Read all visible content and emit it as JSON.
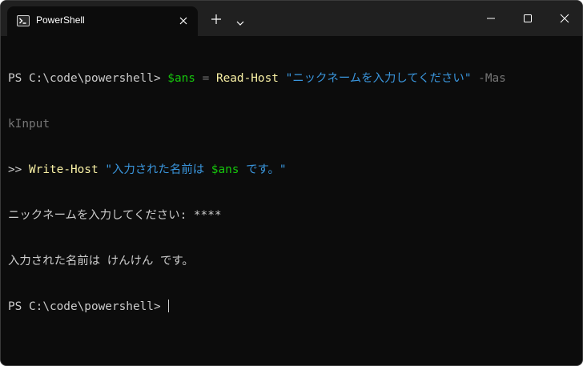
{
  "tab": {
    "title": "PowerShell",
    "icon": "powershell-icon"
  },
  "titlebar": {
    "new_tab_icon": "plus-icon",
    "dropdown_icon": "chevron-down-icon",
    "minimize_icon": "minimize-icon",
    "maximize_icon": "maximize-icon",
    "close_icon": "close-icon"
  },
  "colors": {
    "background": "#0c0c0c",
    "titlebar": "#202020",
    "text": "#cccccc",
    "variable": "#16c60c",
    "command": "#f9f1a5",
    "string": "#3a96dd",
    "parameter": "#767676"
  },
  "terminal": {
    "line1": {
      "prompt": "PS C:\\code\\powershell> ",
      "var": "$ans",
      "op": " = ",
      "cmd": "Read-Host",
      "space": " ",
      "str": "\"ニックネームを入力してください\"",
      "space2": " ",
      "param_part1": "-Mas"
    },
    "line2": {
      "param_part2": "kInput"
    },
    "line3": {
      "prompt": ">> ",
      "cmd": "Write-Host",
      "space": " ",
      "str_start": "\"入力された名前は ",
      "var": "$ans",
      "str_end": " です。\""
    },
    "line4": {
      "text": "ニックネームを入力してください: ****"
    },
    "line5": {
      "text": "入力された名前は けんけん です。"
    },
    "line6": {
      "prompt": "PS C:\\code\\powershell> "
    }
  }
}
